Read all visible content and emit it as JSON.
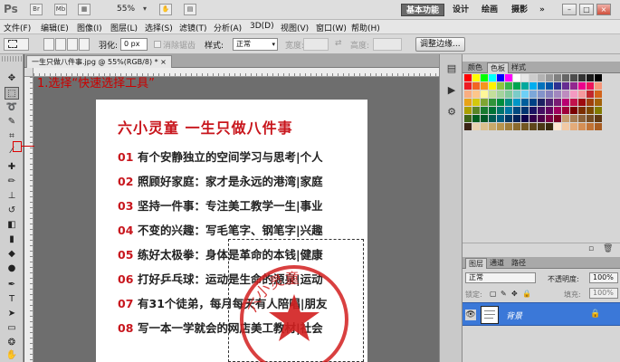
{
  "appbar": {
    "logo": "Ps",
    "icons": [
      "Br",
      "Mb"
    ],
    "zoom": "55%",
    "workspaces": [
      "基本功能",
      "设计",
      "绘画",
      "摄影",
      "»"
    ],
    "window_buttons": [
      "–",
      "□",
      "×"
    ]
  },
  "menu": [
    "文件(F)",
    "编辑(E)",
    "图像(I)",
    "图层(L)",
    "选择(S)",
    "滤镜(T)",
    "分析(A)",
    "3D(D)",
    "视图(V)",
    "窗口(W)",
    "帮助(H)"
  ],
  "options": {
    "feather_label": "羽化:",
    "feather_value": "0 px",
    "antialias_label": "消除锯齿",
    "style_label": "样式:",
    "style_value": "正常",
    "width_label": "宽度:",
    "height_label": "高度:",
    "refine_button": "调整边缘..."
  },
  "document": {
    "tab": "一生只做八件事.jpg @ 55%(RGB/8) *",
    "close": "×"
  },
  "poster": {
    "title": "六小灵童  一生只做八件事",
    "rows": [
      {
        "num": "01",
        "text": "有个安静独立的空间学习与思考|个人"
      },
      {
        "num": "02",
        "text": "照顾好家庭：家才是永远的港湾|家庭"
      },
      {
        "num": "03",
        "text": "坚持一件事：专注美工教学一生|事业"
      },
      {
        "num": "04",
        "text": "不变的兴趣：写毛笔字、钢笔字|兴趣"
      },
      {
        "num": "05",
        "text": "练好太极拳：身体是革命的本钱|健康"
      },
      {
        "num": "06",
        "text": "打好乒乓球：运动是生命的源泉|运动"
      },
      {
        "num": "07",
        "text": "有31个徒弟，每月每天有人陪唱|朋友"
      },
      {
        "num": "08",
        "text": "写一本一学就会的网店美工教材|社会"
      }
    ],
    "stamp_text": "六小灵童"
  },
  "callout": {
    "text": "1.选择“快速选择工具”"
  },
  "panels": {
    "swatch_tabs": [
      "颜色",
      "色板",
      "样式"
    ],
    "swatch_colors": [
      "#ff0000",
      "#ffff00",
      "#00ff00",
      "#00ffff",
      "#0000ff",
      "#ff00ff",
      "#ffffff",
      "#e6e6e6",
      "#cccccc",
      "#b3b3b3",
      "#999999",
      "#808080",
      "#666666",
      "#4d4d4d",
      "#333333",
      "#1a1a1a",
      "#000000",
      "#ed1c24",
      "#f26522",
      "#f7941d",
      "#fff200",
      "#8dc63f",
      "#39b54a",
      "#00a651",
      "#00a99d",
      "#00aeef",
      "#0072bc",
      "#0054a6",
      "#2e3192",
      "#662d91",
      "#92278f",
      "#ec008c",
      "#ed145b",
      "#f7977a",
      "#f9ad81",
      "#fdc68a",
      "#fff79a",
      "#c4df9b",
      "#a3d39c",
      "#82ca9c",
      "#7accc8",
      "#6dcff6",
      "#7da7d9",
      "#8393ca",
      "#8781bd",
      "#a186be",
      "#bd8cbf",
      "#f49ac1",
      "#f5989d",
      "#c1272d",
      "#d3631a",
      "#e8a317",
      "#d4c80d",
      "#7fa533",
      "#30943a",
      "#008c3e",
      "#008c83",
      "#0096c7",
      "#005e9c",
      "#004286",
      "#1c2062",
      "#4e1f6e",
      "#791c74",
      "#b80070",
      "#c2124c",
      "#9e0b0f",
      "#a0410d",
      "#a36209",
      "#aba000",
      "#598527",
      "#197b30",
      "#007236",
      "#00746b",
      "#0076a3",
      "#004a80",
      "#003471",
      "#1b1464",
      "#440e62",
      "#630460",
      "#9e005d",
      "#9e0039",
      "#790000",
      "#7b2e00",
      "#7d4900",
      "#827b00",
      "#406618",
      "#005e20",
      "#005826",
      "#005952",
      "#005b7f",
      "#003663",
      "#002157",
      "#0d004c",
      "#32004b",
      "#4b0049",
      "#7b0046",
      "#7a0026",
      "#c69c6d",
      "#a67c52",
      "#8c6239",
      "#754c24",
      "#603913",
      "#3c2415",
      "#e8d3b0",
      "#d9bf8e",
      "#c8a96b",
      "#b8944e",
      "#a07d3a",
      "#8a6a2e",
      "#735723",
      "#5e461b",
      "#4a3714",
      "#38290d",
      "#fde7d1",
      "#f2c9a4",
      "#e4ab7a",
      "#d58f55",
      "#c27335",
      "#a95d22"
    ],
    "layer_tabs": [
      "图层",
      "通道",
      "路径"
    ],
    "blend_mode": "正常",
    "opacity_label": "不透明度:",
    "opacity_value": "100%",
    "lock_label": "锁定:",
    "fill_label": "填充:",
    "fill_value": "100%",
    "layer_name": "背景"
  }
}
